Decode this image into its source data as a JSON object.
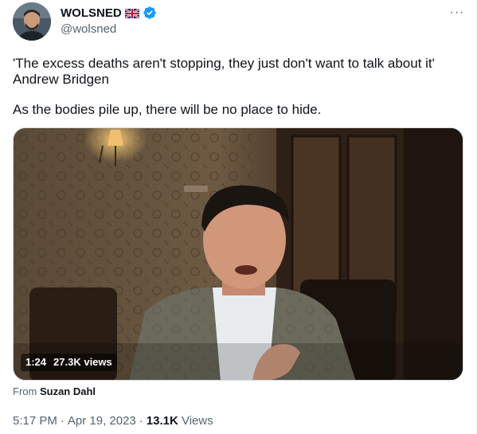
{
  "author": {
    "display_name": "WOLSNED",
    "handle": "@wolsned",
    "flag_icon": "uk-flag-icon",
    "verified_icon": "verified-badge-icon",
    "verified_color": "#1d9bf0"
  },
  "menu": {
    "more_label": "···"
  },
  "tweet": {
    "line1": "'The excess deaths aren't stopping, they just don't want to talk about it'",
    "line2": "Andrew Bridgen",
    "line3": "As the bodies pile up, there will be no place to hide."
  },
  "video": {
    "duration": "1:24",
    "views": "27.3K views"
  },
  "attribution": {
    "prefix": "From",
    "source": "Suzan Dahl"
  },
  "meta": {
    "time": "5:17 PM",
    "separator1": "·",
    "date": "Apr 19, 2023",
    "separator2": "·",
    "view_count": "13.1K",
    "views_label": "Views"
  },
  "colors": {
    "text_primary": "#0f1419",
    "text_secondary": "#536471",
    "border": "#cfd9de"
  }
}
